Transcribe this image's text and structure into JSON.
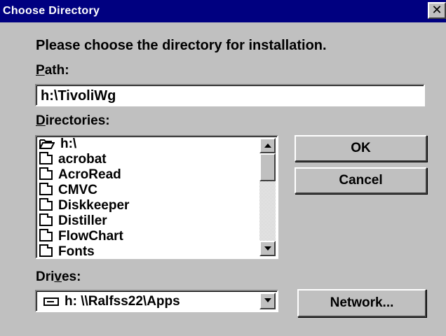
{
  "window": {
    "title": "Choose Directory",
    "close_glyph": "✕"
  },
  "prompt": "Please choose the directory for installation.",
  "path": {
    "label_accel": "P",
    "label_rest": "ath:",
    "value": "h:\\TivoliWg"
  },
  "directories": {
    "label_accel": "D",
    "label_rest": "irectories:",
    "root": "h:\\",
    "items": [
      "acrobat",
      "AcroRead",
      "CMVC",
      "Diskkeeper",
      "Distiller",
      "FlowChart",
      "Fonts"
    ]
  },
  "drives": {
    "label_pre": "Dri",
    "label_accel": "v",
    "label_post": "es:",
    "selected": "h: \\\\Ralfss22\\Apps"
  },
  "buttons": {
    "ok": "OK",
    "cancel": "Cancel",
    "network": "Network..."
  },
  "colors": {
    "titlebar": "#000080",
    "face": "#c0c0c0"
  },
  "icons": [
    "close-icon",
    "open-folder-icon",
    "folder-icon",
    "scroll-up-icon",
    "scroll-down-icon",
    "network-drive-icon",
    "dropdown-arrow-icon"
  ]
}
